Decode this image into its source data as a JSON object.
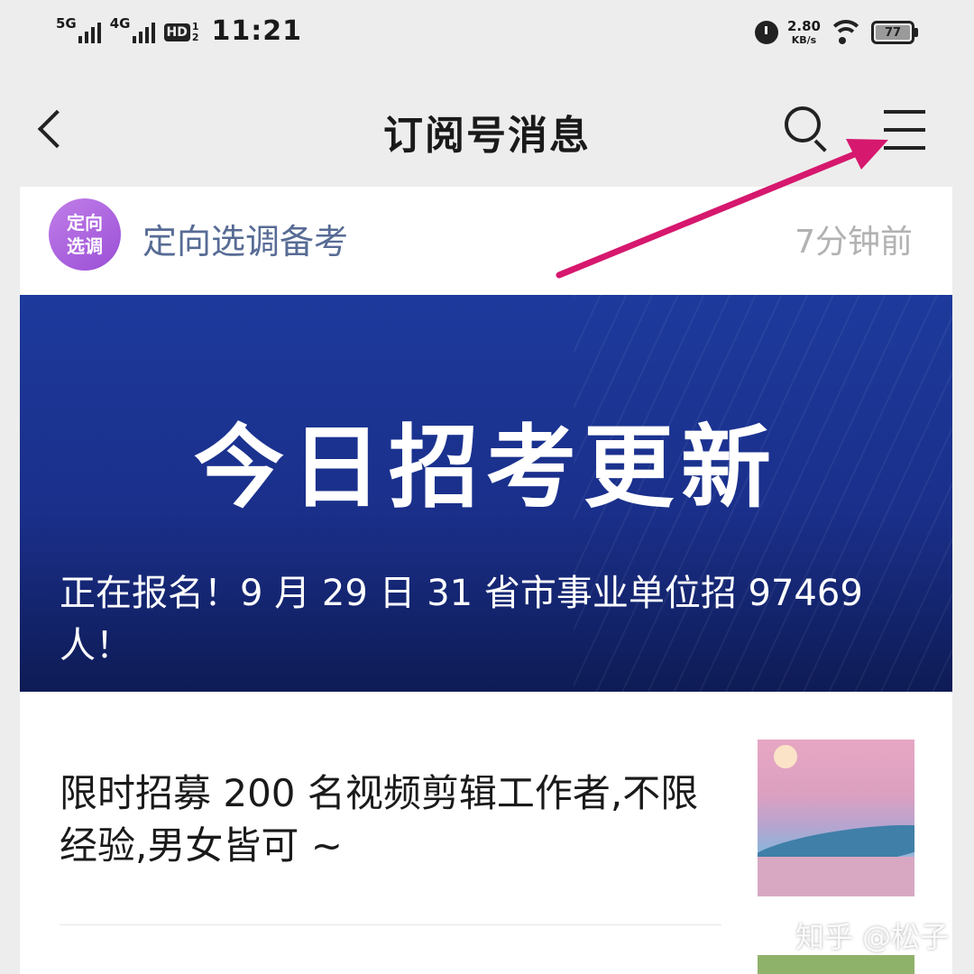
{
  "status_bar": {
    "network1": "5G",
    "network2": "4G",
    "hd": "HD",
    "hd_top": "1",
    "hd_bottom": "2",
    "time": "11:21",
    "speed_value": "2.80",
    "speed_unit": "KB/s",
    "battery": "77"
  },
  "nav": {
    "title": "订阅号消息",
    "back_icon": "chevron-left-icon",
    "search_icon": "search-icon",
    "menu_icon": "hamburger-menu-icon"
  },
  "card": {
    "avatar_line1": "定向",
    "avatar_line2": "选调",
    "account_name": "定向选调备考",
    "timestamp": "7分钟前",
    "banner_headline": "今日招考更新",
    "banner_caption": "正在报名！9 月 29 日 31 省市事业单位招 97469 人！",
    "article1_title": "限时招募 200 名视频剪辑工作者,不限经验,男女皆可 ~"
  },
  "annotation": {
    "color": "#d6186e"
  },
  "watermark": "知乎 @松子"
}
